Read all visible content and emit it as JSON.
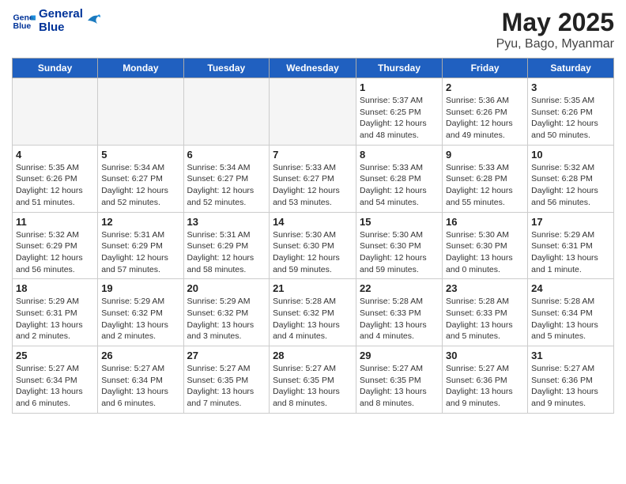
{
  "logo": {
    "line1": "General",
    "line2": "Blue"
  },
  "title": "May 2025",
  "subtitle": "Pyu, Bago, Myanmar",
  "days_of_week": [
    "Sunday",
    "Monday",
    "Tuesday",
    "Wednesday",
    "Thursday",
    "Friday",
    "Saturday"
  ],
  "weeks": [
    [
      {
        "day": "",
        "info": ""
      },
      {
        "day": "",
        "info": ""
      },
      {
        "day": "",
        "info": ""
      },
      {
        "day": "",
        "info": ""
      },
      {
        "day": "1",
        "info": "Sunrise: 5:37 AM\nSunset: 6:25 PM\nDaylight: 12 hours and 48 minutes."
      },
      {
        "day": "2",
        "info": "Sunrise: 5:36 AM\nSunset: 6:26 PM\nDaylight: 12 hours and 49 minutes."
      },
      {
        "day": "3",
        "info": "Sunrise: 5:35 AM\nSunset: 6:26 PM\nDaylight: 12 hours and 50 minutes."
      }
    ],
    [
      {
        "day": "4",
        "info": "Sunrise: 5:35 AM\nSunset: 6:26 PM\nDaylight: 12 hours and 51 minutes."
      },
      {
        "day": "5",
        "info": "Sunrise: 5:34 AM\nSunset: 6:27 PM\nDaylight: 12 hours and 52 minutes."
      },
      {
        "day": "6",
        "info": "Sunrise: 5:34 AM\nSunset: 6:27 PM\nDaylight: 12 hours and 52 minutes."
      },
      {
        "day": "7",
        "info": "Sunrise: 5:33 AM\nSunset: 6:27 PM\nDaylight: 12 hours and 53 minutes."
      },
      {
        "day": "8",
        "info": "Sunrise: 5:33 AM\nSunset: 6:28 PM\nDaylight: 12 hours and 54 minutes."
      },
      {
        "day": "9",
        "info": "Sunrise: 5:33 AM\nSunset: 6:28 PM\nDaylight: 12 hours and 55 minutes."
      },
      {
        "day": "10",
        "info": "Sunrise: 5:32 AM\nSunset: 6:28 PM\nDaylight: 12 hours and 56 minutes."
      }
    ],
    [
      {
        "day": "11",
        "info": "Sunrise: 5:32 AM\nSunset: 6:29 PM\nDaylight: 12 hours and 56 minutes."
      },
      {
        "day": "12",
        "info": "Sunrise: 5:31 AM\nSunset: 6:29 PM\nDaylight: 12 hours and 57 minutes."
      },
      {
        "day": "13",
        "info": "Sunrise: 5:31 AM\nSunset: 6:29 PM\nDaylight: 12 hours and 58 minutes."
      },
      {
        "day": "14",
        "info": "Sunrise: 5:30 AM\nSunset: 6:30 PM\nDaylight: 12 hours and 59 minutes."
      },
      {
        "day": "15",
        "info": "Sunrise: 5:30 AM\nSunset: 6:30 PM\nDaylight: 12 hours and 59 minutes."
      },
      {
        "day": "16",
        "info": "Sunrise: 5:30 AM\nSunset: 6:30 PM\nDaylight: 13 hours and 0 minutes."
      },
      {
        "day": "17",
        "info": "Sunrise: 5:29 AM\nSunset: 6:31 PM\nDaylight: 13 hours and 1 minute."
      }
    ],
    [
      {
        "day": "18",
        "info": "Sunrise: 5:29 AM\nSunset: 6:31 PM\nDaylight: 13 hours and 2 minutes."
      },
      {
        "day": "19",
        "info": "Sunrise: 5:29 AM\nSunset: 6:32 PM\nDaylight: 13 hours and 2 minutes."
      },
      {
        "day": "20",
        "info": "Sunrise: 5:29 AM\nSunset: 6:32 PM\nDaylight: 13 hours and 3 minutes."
      },
      {
        "day": "21",
        "info": "Sunrise: 5:28 AM\nSunset: 6:32 PM\nDaylight: 13 hours and 4 minutes."
      },
      {
        "day": "22",
        "info": "Sunrise: 5:28 AM\nSunset: 6:33 PM\nDaylight: 13 hours and 4 minutes."
      },
      {
        "day": "23",
        "info": "Sunrise: 5:28 AM\nSunset: 6:33 PM\nDaylight: 13 hours and 5 minutes."
      },
      {
        "day": "24",
        "info": "Sunrise: 5:28 AM\nSunset: 6:34 PM\nDaylight: 13 hours and 5 minutes."
      }
    ],
    [
      {
        "day": "25",
        "info": "Sunrise: 5:27 AM\nSunset: 6:34 PM\nDaylight: 13 hours and 6 minutes."
      },
      {
        "day": "26",
        "info": "Sunrise: 5:27 AM\nSunset: 6:34 PM\nDaylight: 13 hours and 6 minutes."
      },
      {
        "day": "27",
        "info": "Sunrise: 5:27 AM\nSunset: 6:35 PM\nDaylight: 13 hours and 7 minutes."
      },
      {
        "day": "28",
        "info": "Sunrise: 5:27 AM\nSunset: 6:35 PM\nDaylight: 13 hours and 8 minutes."
      },
      {
        "day": "29",
        "info": "Sunrise: 5:27 AM\nSunset: 6:35 PM\nDaylight: 13 hours and 8 minutes."
      },
      {
        "day": "30",
        "info": "Sunrise: 5:27 AM\nSunset: 6:36 PM\nDaylight: 13 hours and 9 minutes."
      },
      {
        "day": "31",
        "info": "Sunrise: 5:27 AM\nSunset: 6:36 PM\nDaylight: 13 hours and 9 minutes."
      }
    ]
  ]
}
